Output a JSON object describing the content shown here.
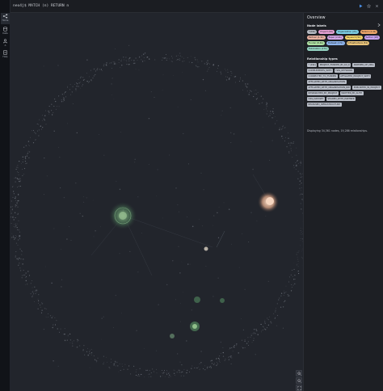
{
  "colors": {
    "background": "#22252c",
    "accent": "#4a8fe7"
  },
  "query": "neo4j$ MATCH (n) RETURN n",
  "rail": [
    {
      "label": "Home",
      "icon": "graph-icon"
    },
    {
      "label": "Data",
      "icon": "database-icon"
    },
    {
      "label": "A",
      "icon": "user-icon"
    },
    {
      "label": "Help",
      "icon": "document-icon"
    }
  ],
  "overview": {
    "title": "Overview",
    "node_labels_title": "Node labels",
    "node_labels": [
      {
        "text": "*(69k)",
        "color": "#b8bcc5"
      },
      {
        "text": "Project (99)",
        "color": "#e9a3d6"
      },
      {
        "text": "Organization (21)",
        "color": "#7ed0e6"
      },
      {
        "text": "Person (1.4k)",
        "color": "#f0a86c"
      },
      {
        "text": "Partner (1.3k)",
        "color": "#eab2a2"
      },
      {
        "text": "Paper (2.4k)",
        "color": "#d6a7e8"
      },
      {
        "text": "Keyword (5k)",
        "color": "#f7d66a"
      },
      {
        "text": "Author (18)",
        "color": "#c6a2f0"
      },
      {
        "text": "Funder (8.4k)",
        "color": "#aee1a3"
      },
      {
        "text": "Dataset (17k)",
        "color": "#8fb5ee"
      },
      {
        "text": "Infrastructure (51)",
        "color": "#e9c47a"
      },
      {
        "text": "Publication (17k)",
        "color": "#94d4c2"
      }
    ],
    "rel_types_title": "Relationship types",
    "rel_types": [
      "* (19k)",
      "PROJECT_FUNDED_BY_KV_K",
      "PARTNER_OF_ORG",
      "COMPLEMENTS_WITH",
      "HAS_KEYWORD",
      "CONNECTED_TO_FUNDER",
      "AFFILIATED_PROJECT_WITH",
      "AFFILIATED_WITH_ORGANISATION",
      "AFFILIATED_WITH_ORGANISATION_RW",
      "PUBLISHED_IN_PROJECT",
      "RESEARCHED_BY_PROJECT",
      "WRITTEN_BY_AUTH",
      "HAS_DATASET",
      "SHARED_WITH_PARTNER",
      "RELEASED_INFRASTRUCTURE"
    ],
    "summary": "Displaying 34,361 nodes, 19,286 relationships."
  }
}
